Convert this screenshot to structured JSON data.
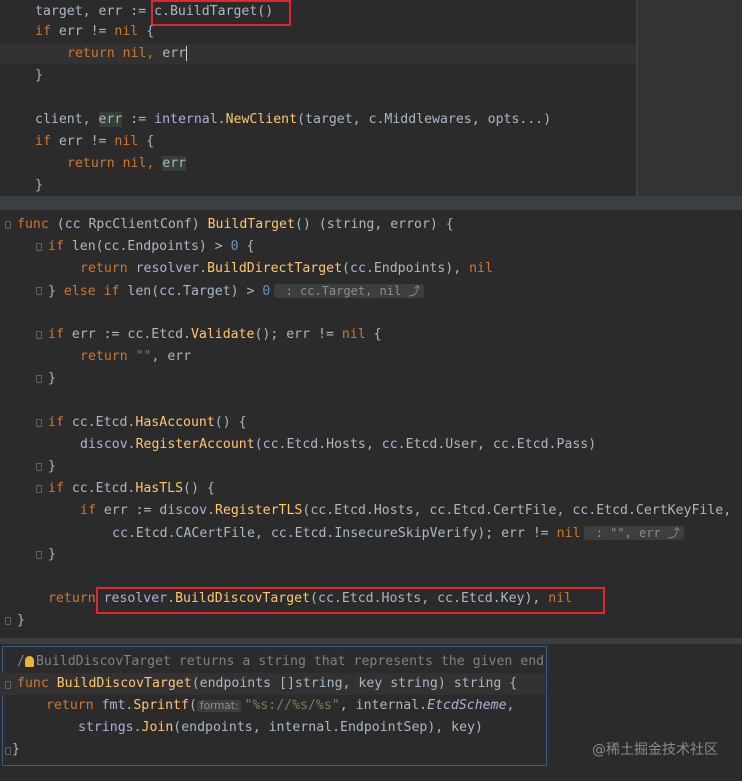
{
  "snippet1": {
    "l1": {
      "a": "target, err := ",
      "b": "c.BuildTarget()"
    },
    "l2": {
      "a": "if",
      "b": " err != ",
      "c": "nil",
      "d": " {"
    },
    "l3": {
      "a": "return",
      "b": " nil, ",
      "c": "err"
    },
    "l4": "}",
    "l5": {
      "a": "client, ",
      "b": "err",
      "c": " := ",
      "d": "internal",
      "e": ".",
      "f": "NewClient",
      "g": "(target, c.Middlewares, opts...)"
    },
    "l6": {
      "a": "if",
      "b": " err != ",
      "c": "nil",
      "d": " {"
    },
    "l7": {
      "a": "return",
      "b": " nil, ",
      "c": "err"
    },
    "l8": "}"
  },
  "snippet2": {
    "l1": {
      "a": "func",
      "b": " (",
      "c": "cc",
      "d": " RpcClientConf",
      "e": ") ",
      "f": "BuildTarget",
      "g": "() (string, error) {"
    },
    "l2": {
      "a": "if",
      "b": " len(",
      "c": "cc",
      "d": ".Endpoints) > ",
      "e": "0",
      "f": " {"
    },
    "l3": {
      "a": "return",
      "b": " resolver",
      "c": ".",
      "d": "BuildDirectTarget",
      "e": "(",
      "f": "cc",
      "g": ".Endpoints), ",
      "h": "nil"
    },
    "l4": {
      "a": "} ",
      "b": "else if",
      "c": " len(",
      "d": "cc",
      "e": ".Target) > ",
      "f": "0",
      "g": " : cc.Target, nil ⤴"
    },
    "l5": {
      "a": "if",
      "b": " err := ",
      "c": "cc",
      "d": ".Etcd.",
      "e": "Validate",
      "f": "(); err != ",
      "g": "nil",
      "h": " {"
    },
    "l6": {
      "a": "return",
      "b": " ",
      "c": "\"\"",
      "d": ", err"
    },
    "l7": "}",
    "l8": {
      "a": "if",
      "b": " ",
      "c": "cc",
      "d": ".Etcd.",
      "e": "HasAccount",
      "f": "() {"
    },
    "l9": {
      "a": "discov",
      "b": ".",
      "c": "RegisterAccount",
      "d": "(",
      "e": "cc",
      "f": ".Etcd.Hosts, ",
      "g": "cc",
      "h": ".Etcd.User, ",
      "i": "cc",
      "j": ".Etcd.Pass)"
    },
    "l10": "}",
    "l11": {
      "a": "if",
      "b": " ",
      "c": "cc",
      "d": ".Etcd.",
      "e": "HasTLS",
      "f": "() {"
    },
    "l12": {
      "a": "if",
      "b": " err := ",
      "c": "discov",
      "d": ".",
      "e": "RegisterTLS",
      "f": "(",
      "g": "cc",
      "h": ".Etcd.Hosts, ",
      "i": "cc",
      "j": ".Etcd.CertFile, ",
      "k": "cc",
      "l": ".Etcd.CertKeyFile,"
    },
    "l13": {
      "a": "cc",
      "b": ".Etcd.CACertFile, ",
      "c": "cc",
      "d": ".Etcd.InsecureSkipVerify); err != ",
      "e": "nil",
      "f": " : \"\", err ⤴"
    },
    "l14": "}",
    "l15": {
      "a": "return",
      "b": " resolver",
      "c": ".",
      "d": "BuildDiscovTarget",
      "e": "(",
      "f": "cc",
      "g": ".Etcd.Hosts, ",
      "h": "cc",
      "i": ".Etcd.Key), ",
      "j": "nil"
    },
    "l16": "}"
  },
  "snippet3": {
    "l1": {
      "a": "/",
      "b": "BuildDiscovTarget returns a string that represents the given end"
    },
    "l2": {
      "a": "func",
      "b": " ",
      "c": "BuildDiscovTarget",
      "d": "(endpoints []string, key string) string {"
    },
    "l3": {
      "a": "return",
      "b": " fmt",
      "c": ".",
      "d": "Sprintf",
      "e": "(",
      "f": "format:",
      "g": "\"%s://%s/%s\"",
      "h": ", internal",
      "i": ".",
      "j": "EtcdScheme",
      "k": ","
    },
    "l4": {
      "a": "strings",
      "b": ".",
      "c": "Join",
      "d": "(endpoints, internal",
      "e": ".EndpointSep), key)"
    },
    "l5": "}"
  },
  "watermark": "@稀土掘金技术社区",
  "colors": {
    "keyword": "#cc7832",
    "function": "#ffc66d",
    "string": "#6a8759",
    "number": "#6897bb",
    "text": "#a9b7c6",
    "highlight_box": "#e0282a"
  }
}
